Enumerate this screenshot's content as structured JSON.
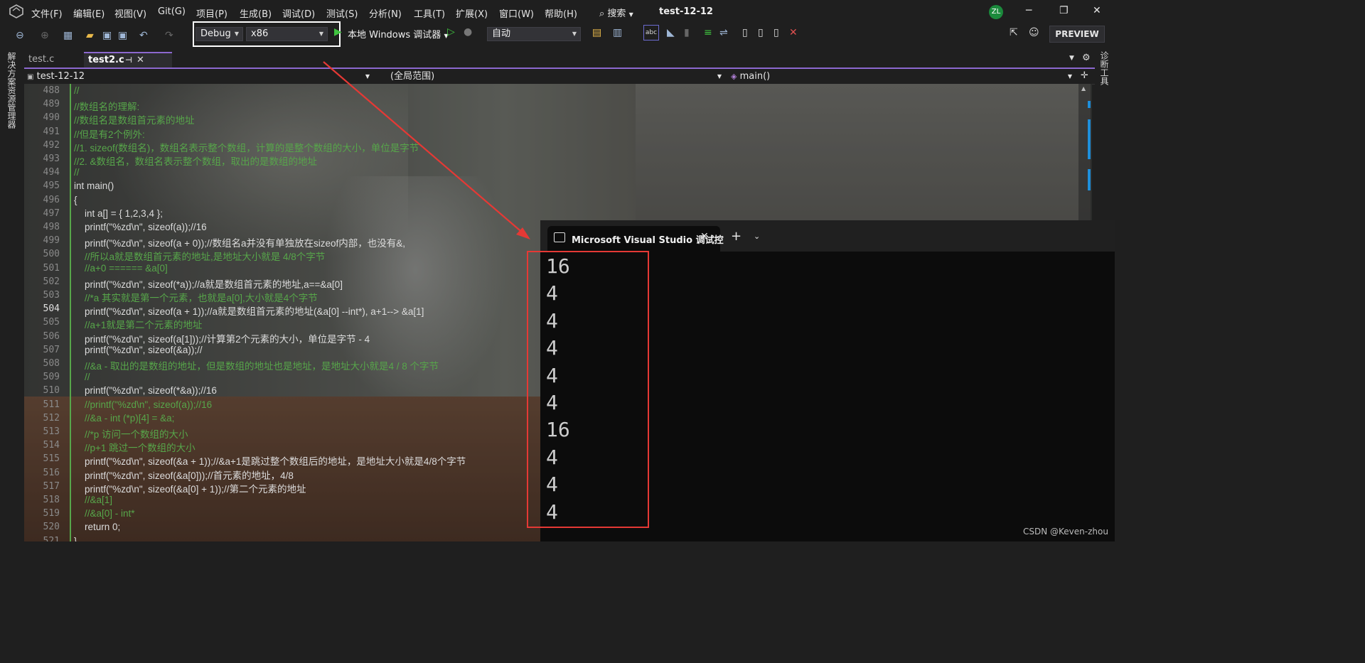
{
  "menubar": {
    "items": [
      "文件(F)",
      "编辑(E)",
      "视图(V)",
      "Git(G)",
      "项目(P)",
      "生成(B)",
      "调试(D)",
      "测试(S)",
      "分析(N)",
      "工具(T)",
      "扩展(X)",
      "窗口(W)",
      "帮助(H)"
    ],
    "search_label": "搜索",
    "title": "test-12-12",
    "avatar": "ZL"
  },
  "toolbar": {
    "config": "Debug",
    "platform": "x86",
    "debugger_label": "本地 Windows 调试器",
    "auto_label": "自动",
    "preview_label": "PREVIEW"
  },
  "side": {
    "left_label": "解决方案资源管理器",
    "right_label": "诊断工具"
  },
  "tabs": [
    {
      "label": "test.c"
    },
    {
      "label": "test2.c"
    }
  ],
  "navbar": {
    "project": "test-12-12",
    "scope": "(全局范围)",
    "member": "main()"
  },
  "editor": {
    "lines": [
      {
        "n": "488",
        "t": "//"
      },
      {
        "n": "489",
        "t": "//数组名的理解:"
      },
      {
        "n": "490",
        "t": "//数组名是数组首元素的地址"
      },
      {
        "n": "491",
        "t": "//但是有2个例外:"
      },
      {
        "n": "492",
        "t": "//1. sizeof(数组名)，数组名表示整个数组，计算的是整个数组的大小，单位是字节"
      },
      {
        "n": "493",
        "t": "//2. &数组名，数组名表示整个数组，取出的是数组的地址"
      },
      {
        "n": "494",
        "t": "//"
      },
      {
        "n": "495",
        "t": "int main()"
      },
      {
        "n": "496",
        "t": "{"
      },
      {
        "n": "497",
        "t": "    int a[] = { 1,2,3,4 };"
      },
      {
        "n": "498",
        "t": "    printf(\"%zd\\n\", sizeof(a));//16"
      },
      {
        "n": "499",
        "t": "    printf(\"%zd\\n\", sizeof(a + 0));//数组名a并没有单独放在sizeof内部，也没有&,"
      },
      {
        "n": "500",
        "t": "    //所以a就是数组首元素的地址,是地址大小就是 4/8个字节"
      },
      {
        "n": "501",
        "t": "    //a+0 ====== &a[0]"
      },
      {
        "n": "502",
        "t": "    printf(\"%zd\\n\", sizeof(*a));//a就是数组首元素的地址,a==&a[0]"
      },
      {
        "n": "503",
        "t": "    //*a 其实就是第一个元素，也就是a[0],大小就是4个字节"
      },
      {
        "n": "504",
        "t": "    printf(\"%zd\\n\", sizeof(a + 1));//a就是数组首元素的地址(&a[0] --int*), a+1--> &a[1]"
      },
      {
        "n": "505",
        "t": "    //a+1就是第二个元素的地址"
      },
      {
        "n": "506",
        "t": "    printf(\"%zd\\n\", sizeof(a[1]));//计算第2个元素的大小，单位是字节 - 4"
      },
      {
        "n": "507",
        "t": "    printf(\"%zd\\n\", sizeof(&a));//"
      },
      {
        "n": "508",
        "t": "    //&a - 取出的是数组的地址，但是数组的地址也是地址，是地址大小就是4 / 8 个字节"
      },
      {
        "n": "509",
        "t": "    //"
      },
      {
        "n": "510",
        "t": "    printf(\"%zd\\n\", sizeof(*&a));//16"
      },
      {
        "n": "511",
        "t": "    //printf(\"%zd\\n\", sizeof(a));//16"
      },
      {
        "n": "512",
        "t": "    //&a - int (*p)[4] = &a;"
      },
      {
        "n": "513",
        "t": "    //*p 访问一个数组的大小"
      },
      {
        "n": "514",
        "t": "    //p+1 跳过一个数组的大小"
      },
      {
        "n": "515",
        "t": "    printf(\"%zd\\n\", sizeof(&a + 1));//&a+1是跳过整个数组后的地址，是地址大小就是4/8个字节"
      },
      {
        "n": "516",
        "t": "    printf(\"%zd\\n\", sizeof(&a[0]));//首元素的地址，4/8"
      },
      {
        "n": "517",
        "t": "    printf(\"%zd\\n\", sizeof(&a[0] + 1));//第二个元素的地址"
      },
      {
        "n": "518",
        "t": "    //&a[1]"
      },
      {
        "n": "519",
        "t": "    //&a[0] - int*"
      },
      {
        "n": "520",
        "t": "    return 0;"
      },
      {
        "n": "521",
        "t": "}"
      }
    ]
  },
  "console": {
    "tab_title": "Microsoft Visual Studio 调试控",
    "output": [
      "16",
      "4",
      "4",
      "4",
      "4",
      "4",
      "16",
      "4",
      "4",
      "4"
    ]
  },
  "watermark": "CSDN @Keven-zhou",
  "colors": {
    "accent": "#8c68cf",
    "highlight_box": "#e53935",
    "comment": "#57a64a",
    "keyword": "#569cd6"
  }
}
